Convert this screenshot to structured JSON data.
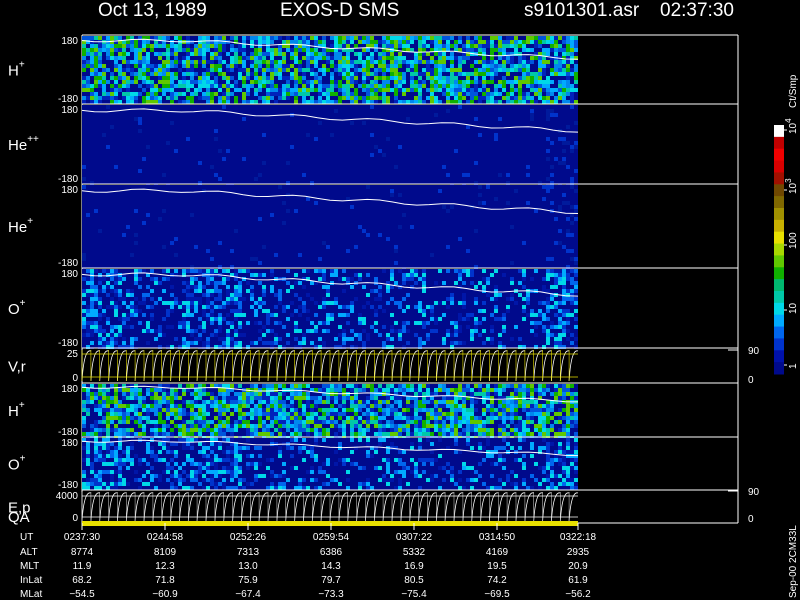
{
  "header": {
    "date": "Oct 13, 1989",
    "mission": "EXOS-D SMS",
    "file": "s9101301.asr",
    "time": "02:37:30"
  },
  "colorbar": {
    "unit": "Ct/Smp",
    "ticks": [
      "1",
      "10",
      "100",
      "10",
      "10"
    ],
    "tick_exponents": [
      "",
      "",
      "",
      "3",
      "4"
    ],
    "colors": [
      "#000a8c",
      "#0011aa",
      "#0033cc",
      "#0066ee",
      "#00aaff",
      "#00d8e8",
      "#00c8a8",
      "#00b870",
      "#10b000",
      "#60c800",
      "#a8d800",
      "#e8e000",
      "#c8b000",
      "#a09000",
      "#806800",
      "#704800",
      "#a01000",
      "#d80000",
      "#f00000",
      "#c00000",
      "#ffffff"
    ]
  },
  "side_labels": {
    "vr_top": "90",
    "vr_bottom": "0",
    "ep_top": "90",
    "ep_bottom": "0",
    "version": "Sep-00 2CM33L"
  },
  "chart_data": {
    "type": "heatmap",
    "panels": [
      {
        "label": "H",
        "sup": "+",
        "ytop": "180",
        "ybot": "-180",
        "kind": "spectrogram",
        "activity": "high"
      },
      {
        "label": "He",
        "sup": "++",
        "ytop": "180",
        "ybot": "-180",
        "kind": "spectrogram",
        "activity": "low"
      },
      {
        "label": "He",
        "sup": "+",
        "ytop": "180",
        "ybot": "-180",
        "kind": "spectrogram",
        "activity": "low"
      },
      {
        "label": "O",
        "sup": "+",
        "ytop": "180",
        "ybot": "-180",
        "kind": "spectrogram",
        "activity": "medium"
      },
      {
        "label": "V,r",
        "sup": "",
        "ytop": "25",
        "ybot": "0",
        "kind": "sweep"
      },
      {
        "label": "H",
        "sup": "+",
        "ytop": "180",
        "ybot": "-180",
        "kind": "spectrogram",
        "activity": "high"
      },
      {
        "label": "O",
        "sup": "+",
        "ytop": "180",
        "ybot": "-180",
        "kind": "spectrogram",
        "activity": "medium"
      },
      {
        "label": "E,p",
        "sup": "",
        "ytop": "4000",
        "ybot": "0",
        "kind": "sweep"
      }
    ],
    "qa_label": "QA",
    "orbit_table": {
      "row_labels": [
        "UT",
        "ALT",
        "MLT",
        "InLat",
        "MLat"
      ],
      "columns": [
        [
          "0237:30",
          "8774",
          "11.9",
          "68.2",
          "-54.5"
        ],
        [
          "0244:58",
          "8109",
          "12.3",
          "71.8",
          "-60.9"
        ],
        [
          "0252:26",
          "7313",
          "13.0",
          "75.9",
          "-67.4"
        ],
        [
          "0259:54",
          "6386",
          "14.3",
          "79.7",
          "-73.3"
        ],
        [
          "0307:22",
          "5332",
          "16.9",
          "80.5",
          "-75.4"
        ],
        [
          "0314:50",
          "4169",
          "19.5",
          "74.2",
          "-69.5"
        ],
        [
          "0322:18",
          "2935",
          "20.9",
          "61.9",
          "-56.2"
        ]
      ]
    }
  }
}
